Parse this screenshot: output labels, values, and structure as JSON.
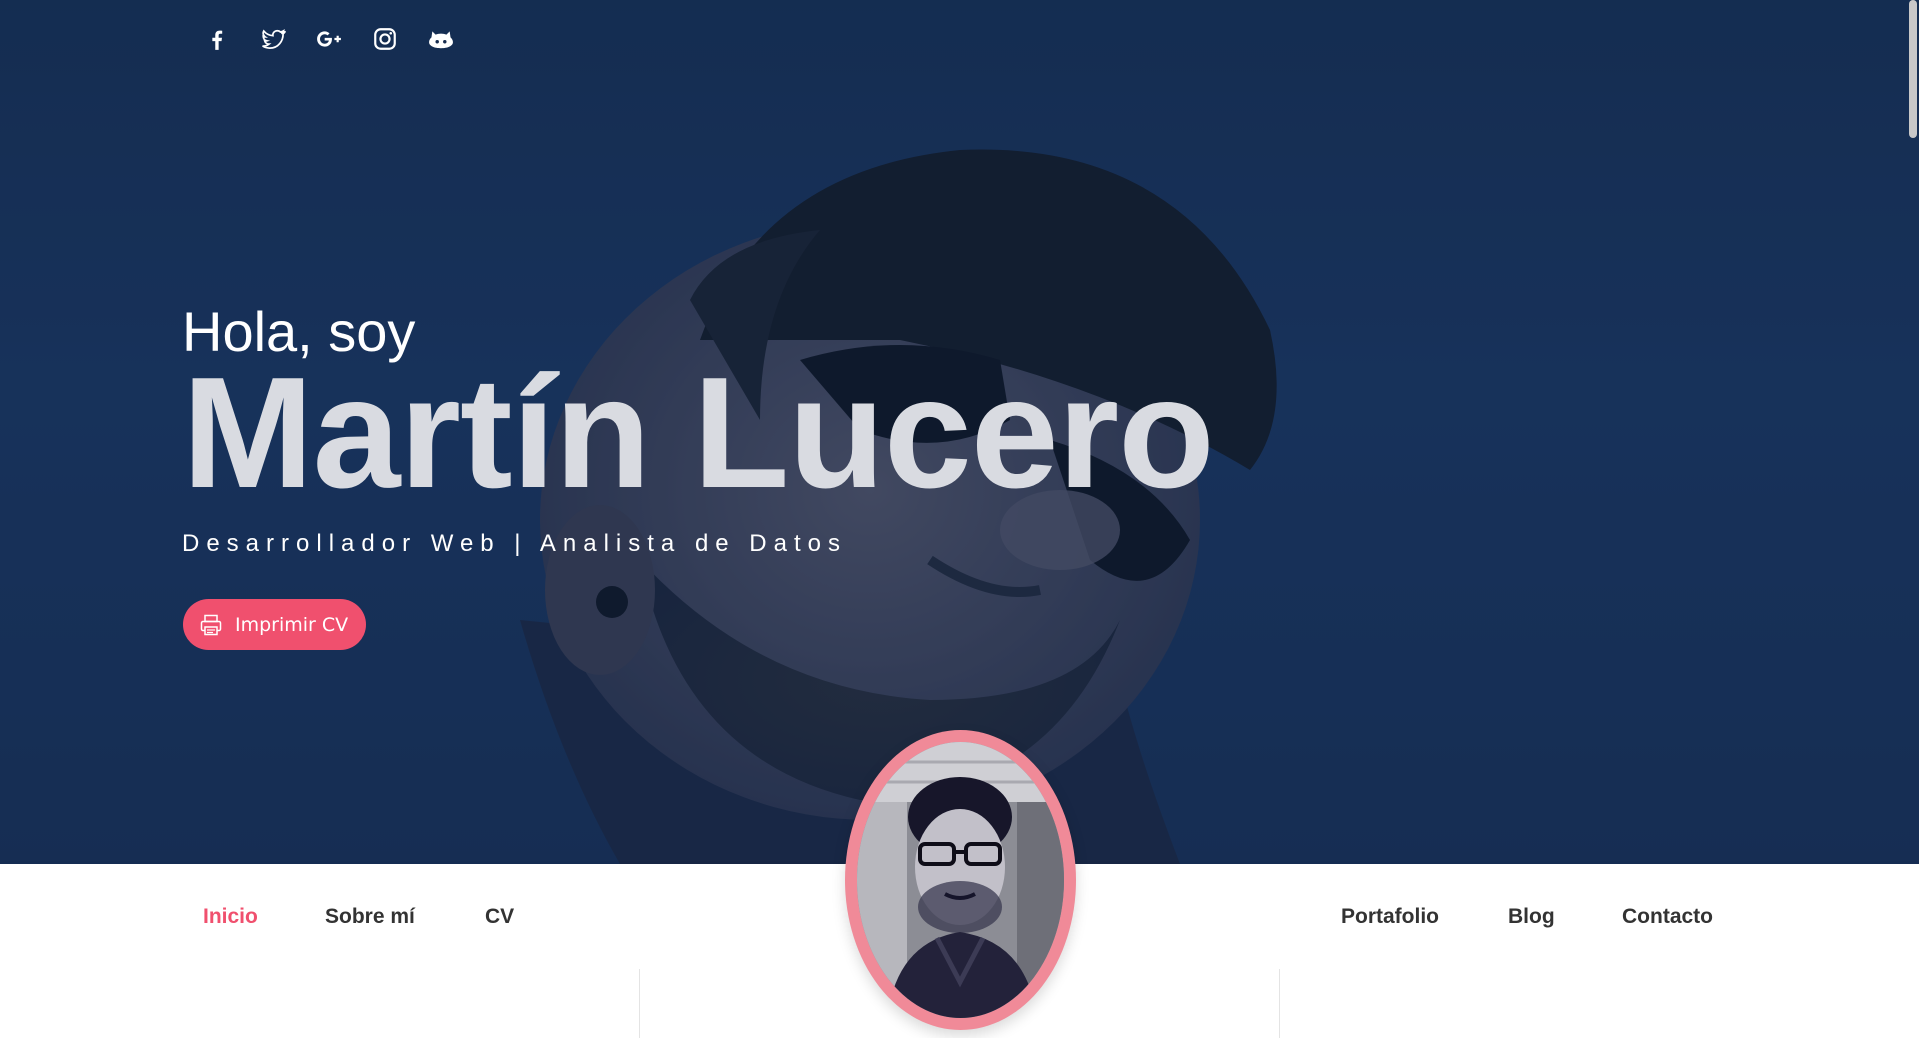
{
  "hero": {
    "greeting": "Hola, soy",
    "name": "Martín Lucero",
    "tagline": "Desarrollador Web | Analista de Datos",
    "cv_button": {
      "label": "Imprimir CV",
      "icon": "printer-icon"
    }
  },
  "socials": [
    {
      "icon": "facebook-icon"
    },
    {
      "icon": "twitter-icon"
    },
    {
      "icon": "google-plus-icon"
    },
    {
      "icon": "instagram-icon"
    },
    {
      "icon": "github-icon"
    }
  ],
  "nav": {
    "left": [
      "Inicio",
      "Sobre mí",
      "CV"
    ],
    "right": [
      "Portafolio",
      "Blog",
      "Contacto"
    ],
    "active": "Inicio"
  },
  "colors": {
    "accent": "#f0506e",
    "hero_bg": "#172c4f",
    "nav_text": "#333333"
  }
}
